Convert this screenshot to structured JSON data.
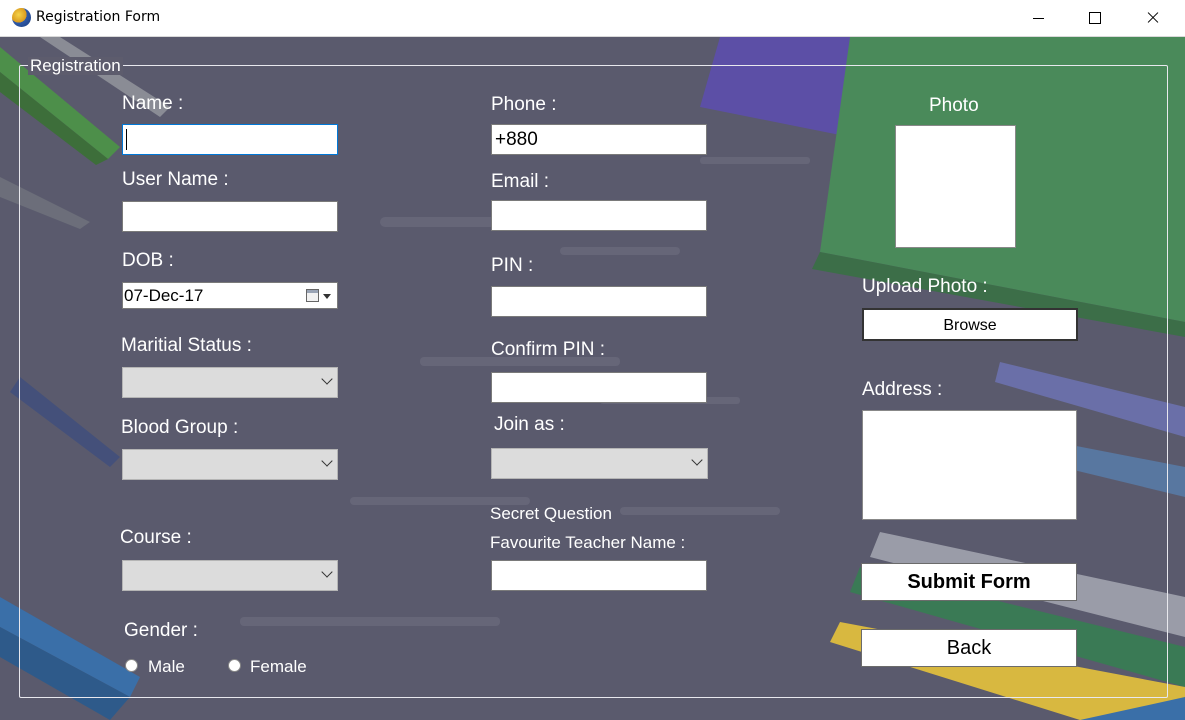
{
  "window": {
    "title": "Registration Form"
  },
  "group": {
    "legend": "Registration"
  },
  "left": {
    "name_label": "Name :",
    "name_value": "",
    "username_label": "User Name :",
    "username_value": "",
    "dob_label": "DOB :",
    "dob_value": "07-Dec-17",
    "marital_label": "Maritial Status :",
    "marital_value": "",
    "blood_label": "Blood Group :",
    "blood_value": "",
    "course_label": "Course :",
    "course_value": "",
    "gender_label": "Gender :",
    "gender_options": [
      "Male",
      "Female"
    ]
  },
  "middle": {
    "phone_label": "Phone :",
    "phone_value": "+880",
    "email_label": "Email :",
    "email_value": "",
    "pin_label": "PIN :",
    "pin_value": "",
    "confirm_pin_label": "Confirm PIN :",
    "confirm_pin_value": "",
    "join_label": "Join as :",
    "join_value": "",
    "secret_question_label": "Secret Question",
    "teacher_label": "Favourite Teacher Name :",
    "teacher_value": ""
  },
  "right": {
    "photo_label": "Photo",
    "upload_label": "Upload Photo :",
    "browse_label": "Browse",
    "address_label": "Address :",
    "submit_label": "Submit Form",
    "back_label": "Back"
  },
  "icons": {
    "app": "app-icon",
    "calendar": "calendar-icon",
    "dropdown": "chevron-down-icon"
  }
}
